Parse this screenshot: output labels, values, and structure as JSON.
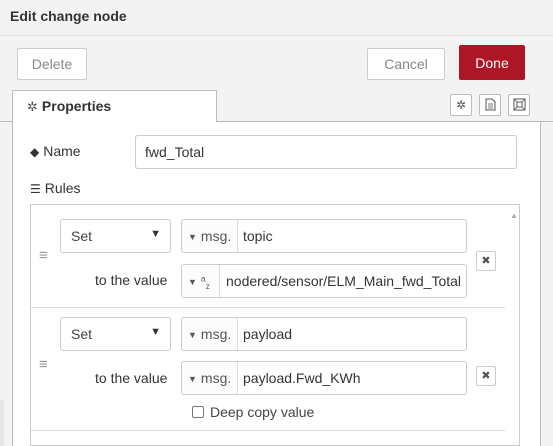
{
  "dialog": {
    "title": "Edit change node",
    "delete_label": "Delete",
    "cancel_label": "Cancel",
    "done_label": "Done"
  },
  "tabs": [
    {
      "label": "Properties",
      "icon": "gear-icon"
    }
  ],
  "tab_icons": [
    "gear-icon",
    "document-icon",
    "frame-icon"
  ],
  "name": {
    "label": "Name",
    "value": "fwd_Total",
    "icon": "tag-icon"
  },
  "rules": {
    "label": "Rules",
    "icon": "list-icon",
    "items": [
      {
        "action": "Set",
        "target_type": "msg.",
        "target_value": "topic",
        "to_label": "to the value",
        "value_type": "a z",
        "value": "nodered/sensor/ELM_Main_fwd_Total"
      },
      {
        "action": "Set",
        "target_type": "msg.",
        "target_value": "payload",
        "to_label": "to the value",
        "value_type": "msg.",
        "value": "payload.Fwd_KWh",
        "deep_copy_label": "Deep copy value",
        "deep_copy_checked": false
      }
    ]
  },
  "colors": {
    "done": "#ad1625",
    "background": "#f3f3f3"
  }
}
